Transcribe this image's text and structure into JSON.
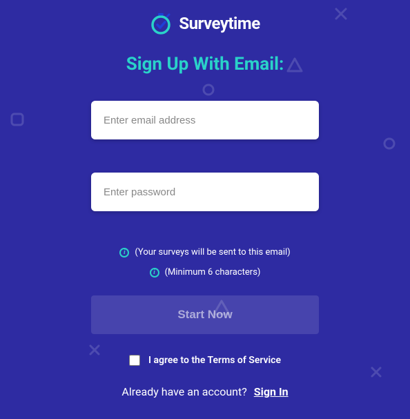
{
  "logo": {
    "text": "Surveytime"
  },
  "heading": "Sign Up With Email:",
  "inputs": {
    "email": {
      "placeholder": "Enter email address",
      "value": ""
    },
    "password": {
      "placeholder": "Enter password",
      "value": ""
    }
  },
  "hints": {
    "email_hint": "(Your surveys will be sent to this email)",
    "password_hint": "(Minimum 6 characters)"
  },
  "buttons": {
    "start": "Start Now"
  },
  "tos": {
    "label": "I agree to the Terms of Service",
    "checked": false
  },
  "signin": {
    "prompt": "Already have an account?",
    "link": "Sign In"
  }
}
